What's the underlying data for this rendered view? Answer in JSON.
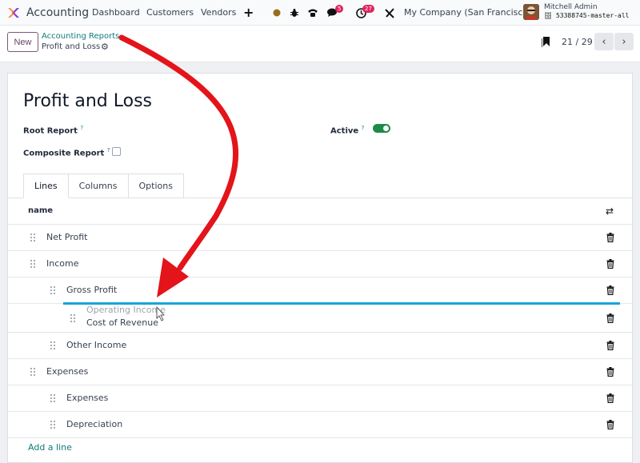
{
  "app": {
    "name": "Accounting"
  },
  "nav": {
    "items": [
      "Dashboard",
      "Customers",
      "Vendors"
    ],
    "plus": "+"
  },
  "systray": {
    "messages_badge": "5",
    "activities_badge": "27",
    "company": "My Company (San Francisco)",
    "user": "Mitchell Admin",
    "database": "53388745-master-all"
  },
  "control": {
    "new_label": "New",
    "breadcrumb_parent": "Accounting Reports",
    "breadcrumb_current": "Profit and Loss",
    "pager": "21 / 29",
    "prev": "‹",
    "next": "›"
  },
  "form": {
    "title": "Profit and Loss",
    "root_report_label": "Root Report",
    "active_label": "Active",
    "composite_label": "Composite Report",
    "help": "?",
    "active": true,
    "composite": false
  },
  "tabs": [
    "Lines",
    "Columns",
    "Options"
  ],
  "lines": {
    "column_header": "name",
    "rows": [
      {
        "name": "Net Profit"
      },
      {
        "name": "Income"
      },
      {
        "name": "Gross Profit"
      },
      {
        "name": "Cost of Revenue"
      },
      {
        "name": "Other Income"
      },
      {
        "name": "Expenses"
      },
      {
        "name": "Expenses"
      },
      {
        "name": "Depreciation"
      }
    ],
    "dragging": "Operating Income",
    "add_line": "Add a line"
  },
  "colors": {
    "accent": "#0e7c7b",
    "arrow": "#e3141a",
    "drop_indicator": "#17a5d4",
    "toggle_on": "#1e8a4a"
  }
}
